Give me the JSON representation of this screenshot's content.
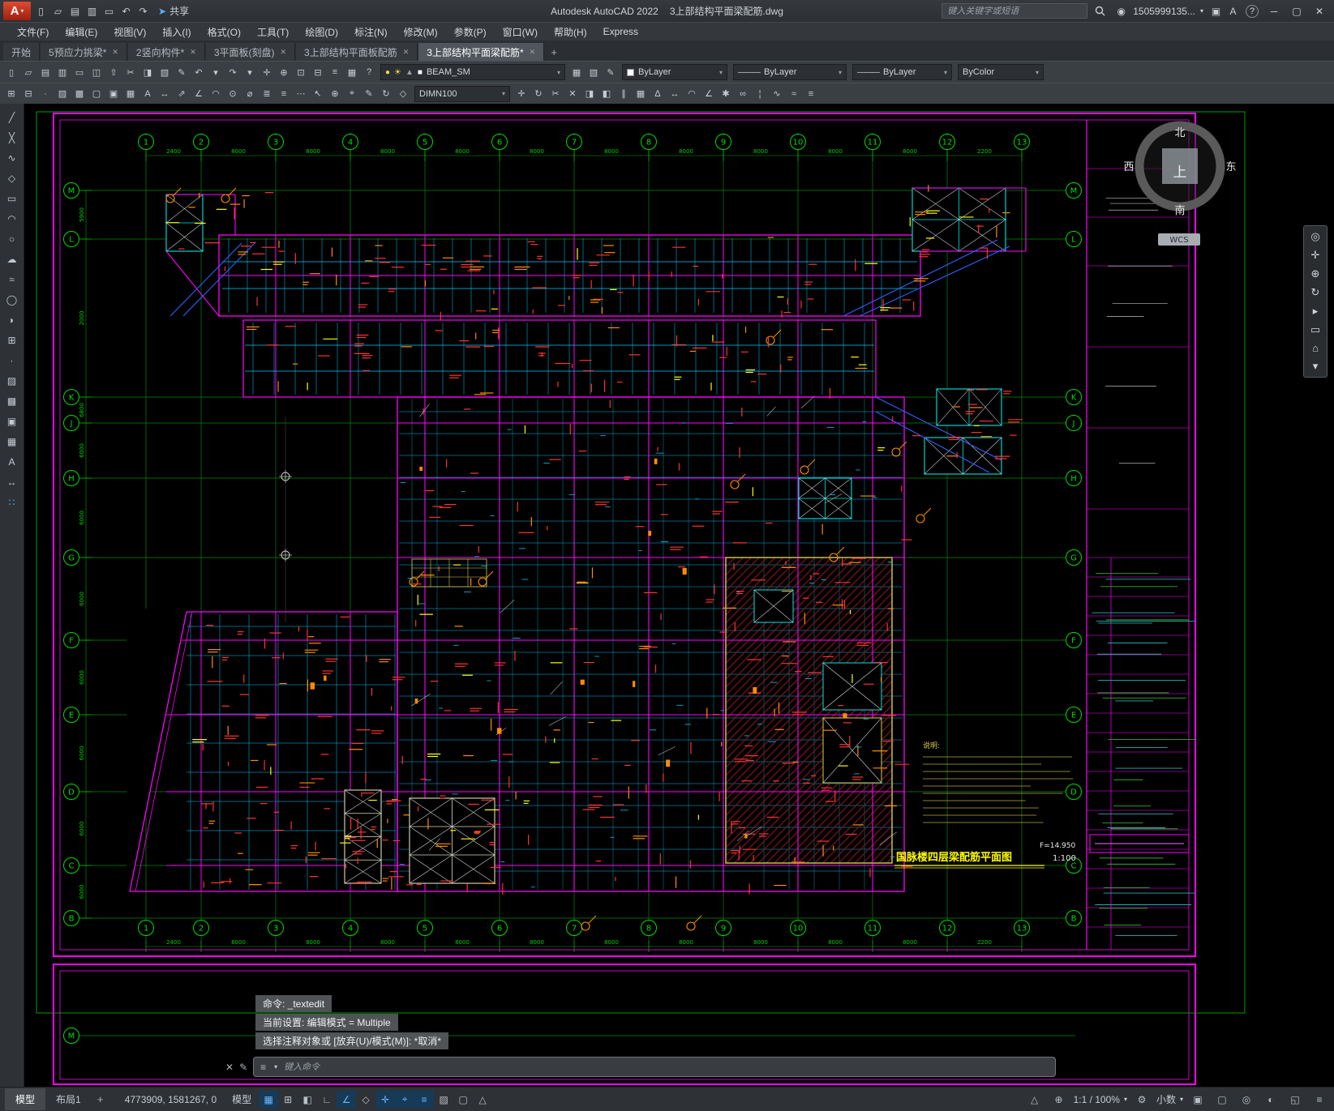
{
  "titlebar": {
    "app_menu_label": "A",
    "quick_icons": [
      {
        "name": "new-file",
        "glyph": "▯"
      },
      {
        "name": "open-folder",
        "glyph": "▱"
      },
      {
        "name": "save",
        "glyph": "▤"
      },
      {
        "name": "save-as",
        "glyph": "▥"
      },
      {
        "name": "plot",
        "glyph": "▭"
      },
      {
        "name": "undo",
        "glyph": "↶"
      },
      {
        "name": "redo",
        "glyph": "↷"
      }
    ],
    "share_icon_glyph": "➤",
    "share_label": "共享",
    "title_app": "Autodesk AutoCAD 2022",
    "title_doc": "3上部结构平面梁配筋.dwg",
    "search_placeholder": "键入关键字或短语",
    "account": "1505999135...",
    "right_icons": [
      {
        "name": "cart",
        "glyph": "▣"
      },
      {
        "name": "autodesk-app-menu",
        "glyph": "A"
      }
    ],
    "help_glyph": "?",
    "window_controls": [
      {
        "name": "minimize",
        "glyph": "─"
      },
      {
        "name": "maximize",
        "glyph": "▢"
      },
      {
        "name": "close",
        "glyph": "✕"
      }
    ]
  },
  "menubar": {
    "items": [
      "文件(F)",
      "编辑(E)",
      "视图(V)",
      "插入(I)",
      "格式(O)",
      "工具(T)",
      "绘图(D)",
      "标注(N)",
      "修改(M)",
      "参数(P)",
      "窗口(W)",
      "帮助(H)",
      "Express"
    ]
  },
  "doc_tabs": {
    "active_index": 5,
    "tabs": [
      {
        "label": "开始",
        "closable": false
      },
      {
        "label": "5预应力挑梁*",
        "closable": true
      },
      {
        "label": "2竖向构件*",
        "closable": true
      },
      {
        "label": "3平面板(刻盘)",
        "closable": true
      },
      {
        "label": "3上部结构平面板配筋",
        "closable": true
      },
      {
        "label": "3上部结构平面梁配筋*",
        "closable": true
      }
    ],
    "add_label": "+"
  },
  "ribbon1": {
    "icons": [
      {
        "name": "new-file",
        "glyph": "▯"
      },
      {
        "name": "open-folder",
        "glyph": "▱"
      },
      {
        "name": "save",
        "glyph": "▤"
      },
      {
        "name": "save-as",
        "glyph": "▥"
      },
      {
        "name": "plot",
        "glyph": "▭"
      },
      {
        "name": "plot-preview",
        "glyph": "◫"
      },
      {
        "name": "publish",
        "glyph": "⇧"
      },
      {
        "name": "cut",
        "glyph": "✂"
      },
      {
        "name": "copy",
        "glyph": "◨"
      },
      {
        "name": "paste",
        "glyph": "▧"
      },
      {
        "name": "match-properties",
        "glyph": "✎"
      },
      {
        "name": "undo",
        "glyph": "↶"
      },
      {
        "name": "undo-options",
        "glyph": "▾"
      },
      {
        "name": "redo",
        "glyph": "↷"
      },
      {
        "name": "redo-options",
        "glyph": "▾"
      },
      {
        "name": "pan",
        "glyph": "✛"
      },
      {
        "name": "zoom-realtime",
        "glyph": "⊕"
      },
      {
        "name": "zoom-window",
        "glyph": "⊡"
      },
      {
        "name": "zoom-previous",
        "glyph": "⊟"
      },
      {
        "name": "properties-palette",
        "glyph": "≡"
      },
      {
        "name": "sheet-set-manager",
        "glyph": "▦"
      },
      {
        "name": "help",
        "glyph": "?"
      }
    ],
    "layer_state_icons": [
      {
        "name": "layer-on",
        "glyph": "●",
        "color": "#f7d94c"
      },
      {
        "name": "layer-thaw",
        "glyph": "☀",
        "color": "#f7d94c"
      },
      {
        "name": "layer-lock",
        "glyph": "▲",
        "color": "#9aa0a6"
      },
      {
        "name": "layer-color-swatch",
        "glyph": "■",
        "color": "#ffffff"
      }
    ],
    "layer_value": "BEAM_SM",
    "between_icons": [
      {
        "name": "layer-properties",
        "glyph": "▦"
      },
      {
        "name": "layer-states",
        "glyph": "▧"
      },
      {
        "name": "match-layer",
        "glyph": "✎"
      }
    ],
    "color_value": "ByLayer",
    "linetype_value": "ByLayer",
    "lineweight_value": "ByLayer",
    "plotstyle_value": "ByColor"
  },
  "ribbon2": {
    "icons_left": [
      {
        "name": "insert-block",
        "glyph": "⊞"
      },
      {
        "name": "create-block",
        "glyph": "⊟"
      },
      {
        "name": "point-tool",
        "glyph": "∙"
      },
      {
        "name": "hatch",
        "glyph": "▨"
      },
      {
        "name": "gradient",
        "glyph": "▩"
      },
      {
        "name": "boundary",
        "glyph": "▢"
      },
      {
        "name": "region",
        "glyph": "▣"
      },
      {
        "name": "table",
        "glyph": "▦"
      },
      {
        "name": "multiline-text",
        "glyph": "A"
      },
      {
        "name": "linear-dimension",
        "glyph": "↔"
      },
      {
        "name": "aligned-dimension",
        "glyph": "⇗"
      },
      {
        "name": "angular-dimension",
        "glyph": "∠"
      },
      {
        "name": "arc-dimension",
        "glyph": "◠"
      },
      {
        "name": "radius-dimension",
        "glyph": "⊙"
      },
      {
        "name": "diameter-dimension",
        "glyph": "⌀"
      },
      {
        "name": "quick-dimension",
        "glyph": "≣"
      },
      {
        "name": "baseline-dimension",
        "glyph": "≡"
      },
      {
        "name": "continue-dimension",
        "glyph": "⋯"
      },
      {
        "name": "multileader",
        "glyph": "↖"
      },
      {
        "name": "tolerance",
        "glyph": "⊕"
      },
      {
        "name": "center-mark",
        "glyph": "⌖"
      },
      {
        "name": "dimension-edit",
        "glyph": "✎"
      },
      {
        "name": "dimension-update",
        "glyph": "↻"
      },
      {
        "name": "dimension-style",
        "glyph": "◇"
      }
    ],
    "dim_value": "DIMN100",
    "icons_right": [
      {
        "name": "move",
        "glyph": "✛"
      },
      {
        "name": "rotate",
        "glyph": "↻"
      },
      {
        "name": "trim",
        "glyph": "✂"
      },
      {
        "name": "erase",
        "glyph": "✕"
      },
      {
        "name": "copy-object",
        "glyph": "◨"
      },
      {
        "name": "mirror",
        "glyph": "◧"
      },
      {
        "name": "offset",
        "glyph": "∥"
      },
      {
        "name": "array",
        "glyph": "▦"
      },
      {
        "name": "scale-tool",
        "glyph": "∆"
      },
      {
        "name": "stretch",
        "glyph": "↔"
      },
      {
        "name": "fillet",
        "glyph": "◠"
      },
      {
        "name": "chamfer",
        "glyph": "∠"
      },
      {
        "name": "explode",
        "glyph": "✱"
      },
      {
        "name": "join",
        "glyph": "∞"
      },
      {
        "name": "break",
        "glyph": "¦"
      },
      {
        "name": "polyline-edit",
        "glyph": "∿"
      },
      {
        "name": "spline-edit",
        "glyph": "≈"
      },
      {
        "name": "object-properties",
        "glyph": "≡"
      }
    ]
  },
  "left_palette": {
    "tools": [
      {
        "name": "line",
        "glyph": "╱"
      },
      {
        "name": "construction-line",
        "glyph": "╳"
      },
      {
        "name": "polyline",
        "glyph": "∿"
      },
      {
        "name": "polygon",
        "glyph": "◇"
      },
      {
        "name": "rectangle",
        "glyph": "▭"
      },
      {
        "name": "arc",
        "glyph": "◠"
      },
      {
        "name": "circle",
        "glyph": "○"
      },
      {
        "name": "revision-cloud",
        "glyph": "☁"
      },
      {
        "name": "spline",
        "glyph": "≈"
      },
      {
        "name": "ellipse",
        "glyph": "◯"
      },
      {
        "name": "ellipse-arc",
        "glyph": "◗"
      },
      {
        "name": "insert-block",
        "glyph": "⊞"
      },
      {
        "name": "point",
        "glyph": "∙"
      },
      {
        "name": "hatch",
        "glyph": "▨"
      },
      {
        "name": "gradient",
        "glyph": "▩"
      },
      {
        "name": "region",
        "glyph": "▣"
      },
      {
        "name": "table",
        "glyph": "▦"
      },
      {
        "name": "text",
        "glyph": "A"
      },
      {
        "name": "dimension",
        "glyph": "↔"
      },
      {
        "name": "tool-palettes",
        "glyph": "∷",
        "color": "#57b0ff"
      }
    ]
  },
  "navbar": {
    "tools": [
      {
        "name": "full-navigation-wheel",
        "glyph": "◎"
      },
      {
        "name": "pan",
        "glyph": "✛"
      },
      {
        "name": "zoom-extents",
        "glyph": "⊕"
      },
      {
        "name": "orbit",
        "glyph": "↻"
      },
      {
        "name": "show-motion",
        "glyph": "▸"
      },
      {
        "name": "view-controls",
        "glyph": "▭"
      },
      {
        "name": "home-view",
        "glyph": "⌂"
      },
      {
        "name": "navigation-settings",
        "glyph": "▾"
      }
    ]
  },
  "command": {
    "history": [
      "命令: _textedit",
      "当前设置: 编辑模式 = Multiple",
      "选择注释对象或 [放弃(U)/模式(M)]: *取消*"
    ],
    "close_glyph": "✕",
    "edit_glyph": "✎",
    "customize_glyph": "≡",
    "input_placeholder": "键入命令"
  },
  "layout_tabs": {
    "tabs": [
      {
        "label": "模型",
        "active": true
      },
      {
        "label": "布局1",
        "active": false
      }
    ],
    "add_label": "+"
  },
  "statusbar": {
    "coords": "4773909, 1581267, 0",
    "model_toggle": "模型",
    "toggles": [
      {
        "name": "grid-display",
        "glyph": "▦",
        "active": true
      },
      {
        "name": "snap-mode",
        "glyph": "⊞",
        "active": false
      },
      {
        "name": "infer-constraints",
        "glyph": "◧",
        "active": false
      },
      {
        "name": "ortho-mode",
        "glyph": "∟",
        "active": false
      },
      {
        "name": "polar-tracking",
        "glyph": "∠",
        "active": true
      },
      {
        "name": "isometric-drafting",
        "glyph": "◇",
        "active": false
      },
      {
        "name": "object-snap-tracking",
        "glyph": "✛",
        "active": true
      },
      {
        "name": "object-snap",
        "glyph": "⌖",
        "active": true
      },
      {
        "name": "lineweight-display",
        "glyph": "≡",
        "active": true
      },
      {
        "name": "transparency",
        "glyph": "▨",
        "active": false
      },
      {
        "name": "selection-cycling",
        "glyph": "▢",
        "active": false
      },
      {
        "name": "annotation-monitor",
        "glyph": "△",
        "active": false
      }
    ],
    "right_items": [
      {
        "type": "icon",
        "name": "annotation-visibility",
        "glyph": "△"
      },
      {
        "type": "icon",
        "name": "annotation-autoscale",
        "glyph": "⊕"
      },
      {
        "type": "label",
        "name": "annotation-scale",
        "text": "1:1 / 100%",
        "caret": true
      },
      {
        "type": "icon",
        "name": "workspace-switching",
        "glyph": "⚙"
      },
      {
        "type": "label",
        "name": "units",
        "text": "小数",
        "caret": true
      },
      {
        "type": "icon",
        "name": "annotation-scale-sync",
        "glyph": "▣"
      },
      {
        "type": "icon",
        "name": "quick-properties",
        "glyph": "▢"
      },
      {
        "type": "icon",
        "name": "isolate-objects",
        "glyph": "◎"
      },
      {
        "type": "icon",
        "name": "hardware-acceleration",
        "glyph": "◐"
      },
      {
        "type": "icon",
        "name": "clean-screen",
        "glyph": "◱"
      },
      {
        "type": "icon",
        "name": "customize",
        "glyph": "≡"
      }
    ]
  },
  "drawing": {
    "grid_cols": [
      "1",
      "2",
      "3",
      "4",
      "5",
      "6",
      "7",
      "8",
      "9",
      "10",
      "11",
      "12",
      "13"
    ],
    "grid_rows": [
      "M",
      "L",
      "K",
      "J",
      "H",
      "G",
      "F",
      "E",
      "D",
      "C",
      "B"
    ],
    "dims_top": [
      "2400",
      "8000",
      "8000",
      "8000",
      "8000",
      "8000",
      "8000",
      "8000",
      "8000",
      "8000",
      "8000",
      "2200"
    ],
    "dims_left": [
      "5900",
      "2000",
      "6800",
      "6000",
      "6000",
      "6000",
      "6000",
      "6000",
      "6000",
      "6000"
    ],
    "plan_title": "国脉楼四层梁配筋平面图",
    "plan_scale": "1:100",
    "elevation_note": "F=14.950",
    "notes_title": "说明:",
    "compass": {
      "n": "北",
      "s": "南",
      "w": "西",
      "e": "东",
      "center": "上",
      "wcs": "WCS"
    },
    "colors": {
      "grid": "#008a00",
      "grid_bright": "#00dc00",
      "beam_main": "#ff00ff",
      "beam_sec": "#00c8ff",
      "annotation": "#ff3232",
      "annotation2": "#ff8c00",
      "hatch": "#7a1515",
      "sheet": "#ff00ff",
      "wing": "#2e62ff",
      "core": "#00e5e5",
      "note": "#d8cc50"
    }
  }
}
